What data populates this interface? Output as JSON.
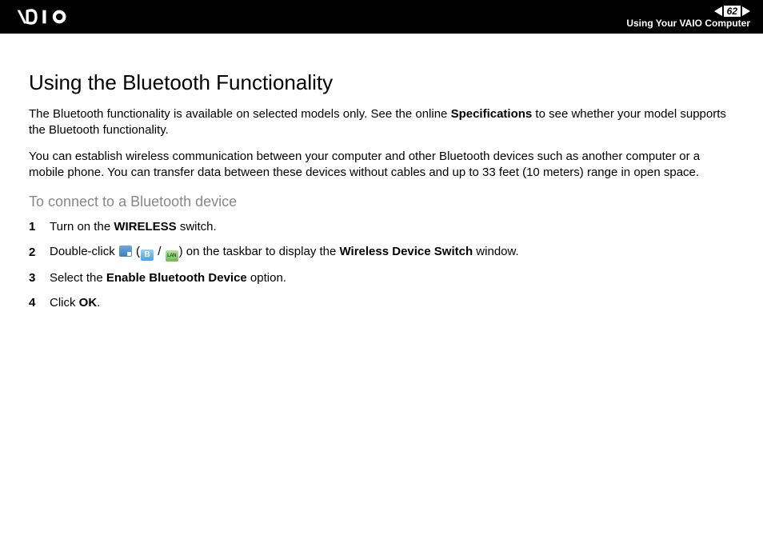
{
  "header": {
    "page_number": "62",
    "breadcrumb": "Using Your VAIO Computer"
  },
  "content": {
    "title": "Using the Bluetooth Functionality",
    "para1_pre": "The Bluetooth functionality is available on selected models only. See the online ",
    "para1_bold": "Specifications",
    "para1_post": " to see whether your model supports the Bluetooth functionality.",
    "para2": "You can establish wireless communication between your computer and other Bluetooth devices such as another computer or a mobile phone. You can transfer data between these devices without cables and up to 33 feet (10 meters) range in open space.",
    "subtitle": "To connect to a Bluetooth device",
    "steps": {
      "s1": {
        "num": "1",
        "pre": "Turn on the ",
        "b1": "WIRELESS",
        "post": " switch."
      },
      "s2": {
        "num": "2",
        "pre": "Double-click ",
        "mid1": " (",
        "sep": " / ",
        "mid2": ") on the taskbar to display the ",
        "b1": "Wireless Device Switch",
        "post": " window."
      },
      "s3": {
        "num": "3",
        "pre": "Select the ",
        "b1": "Enable Bluetooth Device",
        "post": " option."
      },
      "s4": {
        "num": "4",
        "pre": "Click ",
        "b1": "OK",
        "post": "."
      }
    },
    "icon_b_label": "B",
    "icon_lan_label": "LAN"
  }
}
